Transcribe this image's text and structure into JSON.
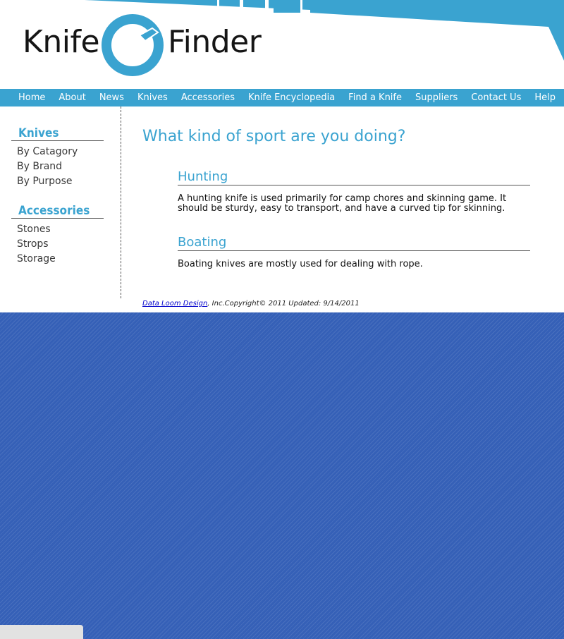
{
  "brand": {
    "word1": "Knife",
    "word2": "Finder",
    "accent": "#3aa3d0",
    "mark_icon": "knife-circle-icon"
  },
  "nav": {
    "items": [
      "Home",
      "About",
      "News",
      "Knives",
      "Accessories",
      "Knife Encyclopedia",
      "Find a Knife",
      "Suppliers",
      "Contact Us",
      "Help"
    ]
  },
  "sidebar": {
    "knives": {
      "heading": "Knives",
      "items": [
        "By Catagory",
        "By Brand",
        "By Purpose"
      ]
    },
    "accessories": {
      "heading": "Accessories",
      "items": [
        "Stones",
        "Strops",
        "Storage"
      ]
    }
  },
  "main": {
    "title": "What kind of sport are you doing?",
    "sections": [
      {
        "heading": "Hunting",
        "text": "A hunting knife is used primarily for camp chores and skinning game. It should be sturdy, easy to transport, and have a curved tip for skinning."
      },
      {
        "heading": "Boating",
        "text": "Boating knives are mostly used for dealing with rope."
      }
    ]
  },
  "footer": {
    "link": "Data Loom Design",
    "text": ", Inc.Copyright© 2011 Updated: 9/14/2011"
  },
  "colors": {
    "nav_bg": "#3aa3d0",
    "page_bg": "#3560b7"
  }
}
